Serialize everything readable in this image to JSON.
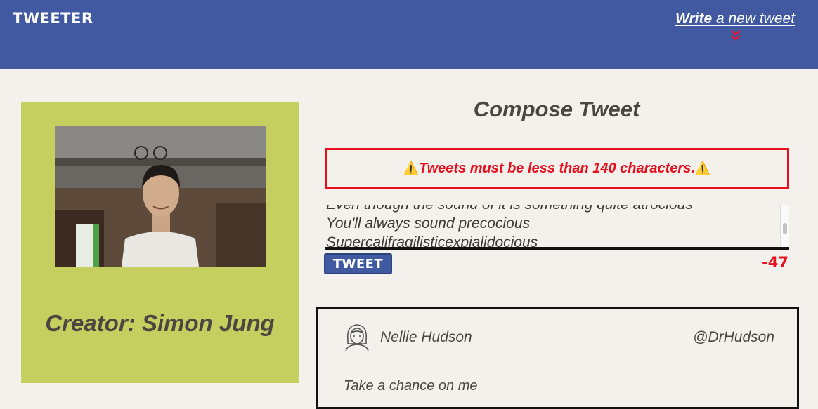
{
  "header": {
    "brand": "TWEETER",
    "compose_link_strong": "Write",
    "compose_link_rest": " a new tweet"
  },
  "profile": {
    "creator_label": "Creator: Simon Jung"
  },
  "compose": {
    "title": "Compose Tweet",
    "error_message": "Tweets must be less than 140 characters.",
    "warning_glyph": "⚠️",
    "textarea_lines": [
      "Even though the sound of it is something quite atrocious",
      "You'll always sound precocious",
      "Supercalifragilisticexpialidocious"
    ],
    "submit_label": "TWEET",
    "char_counter": "-47"
  },
  "tweets": [
    {
      "name": "Nellie Hudson",
      "handle": "@DrHudson",
      "body": "Take a chance on me"
    }
  ],
  "colors": {
    "header_bg": "#4059a0",
    "page_bg": "#f4f1ec",
    "profile_bg": "#c4cf5f",
    "error": "#e8101e",
    "text": "#4a4742"
  }
}
